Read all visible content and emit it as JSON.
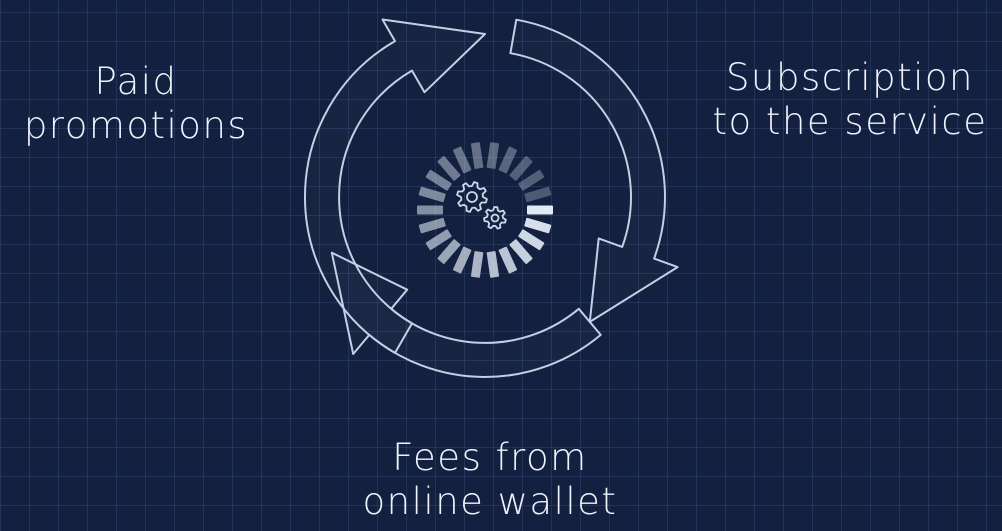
{
  "labels": {
    "left": {
      "line1": "Paid",
      "line2": "promotions"
    },
    "right": {
      "line1": "Subscription",
      "line2": "to the service"
    },
    "bottom": {
      "line1": "Fees from",
      "line2": "online wallet"
    }
  },
  "colors": {
    "background": "#13203f",
    "grid": "#2a3a63",
    "arrow_outline": "#c3cfe2",
    "text": "#eef2fa",
    "gear": "#cfd8e8"
  },
  "icons": {
    "center": "gears-icon",
    "arrows": "cycle-arrows-icon"
  }
}
